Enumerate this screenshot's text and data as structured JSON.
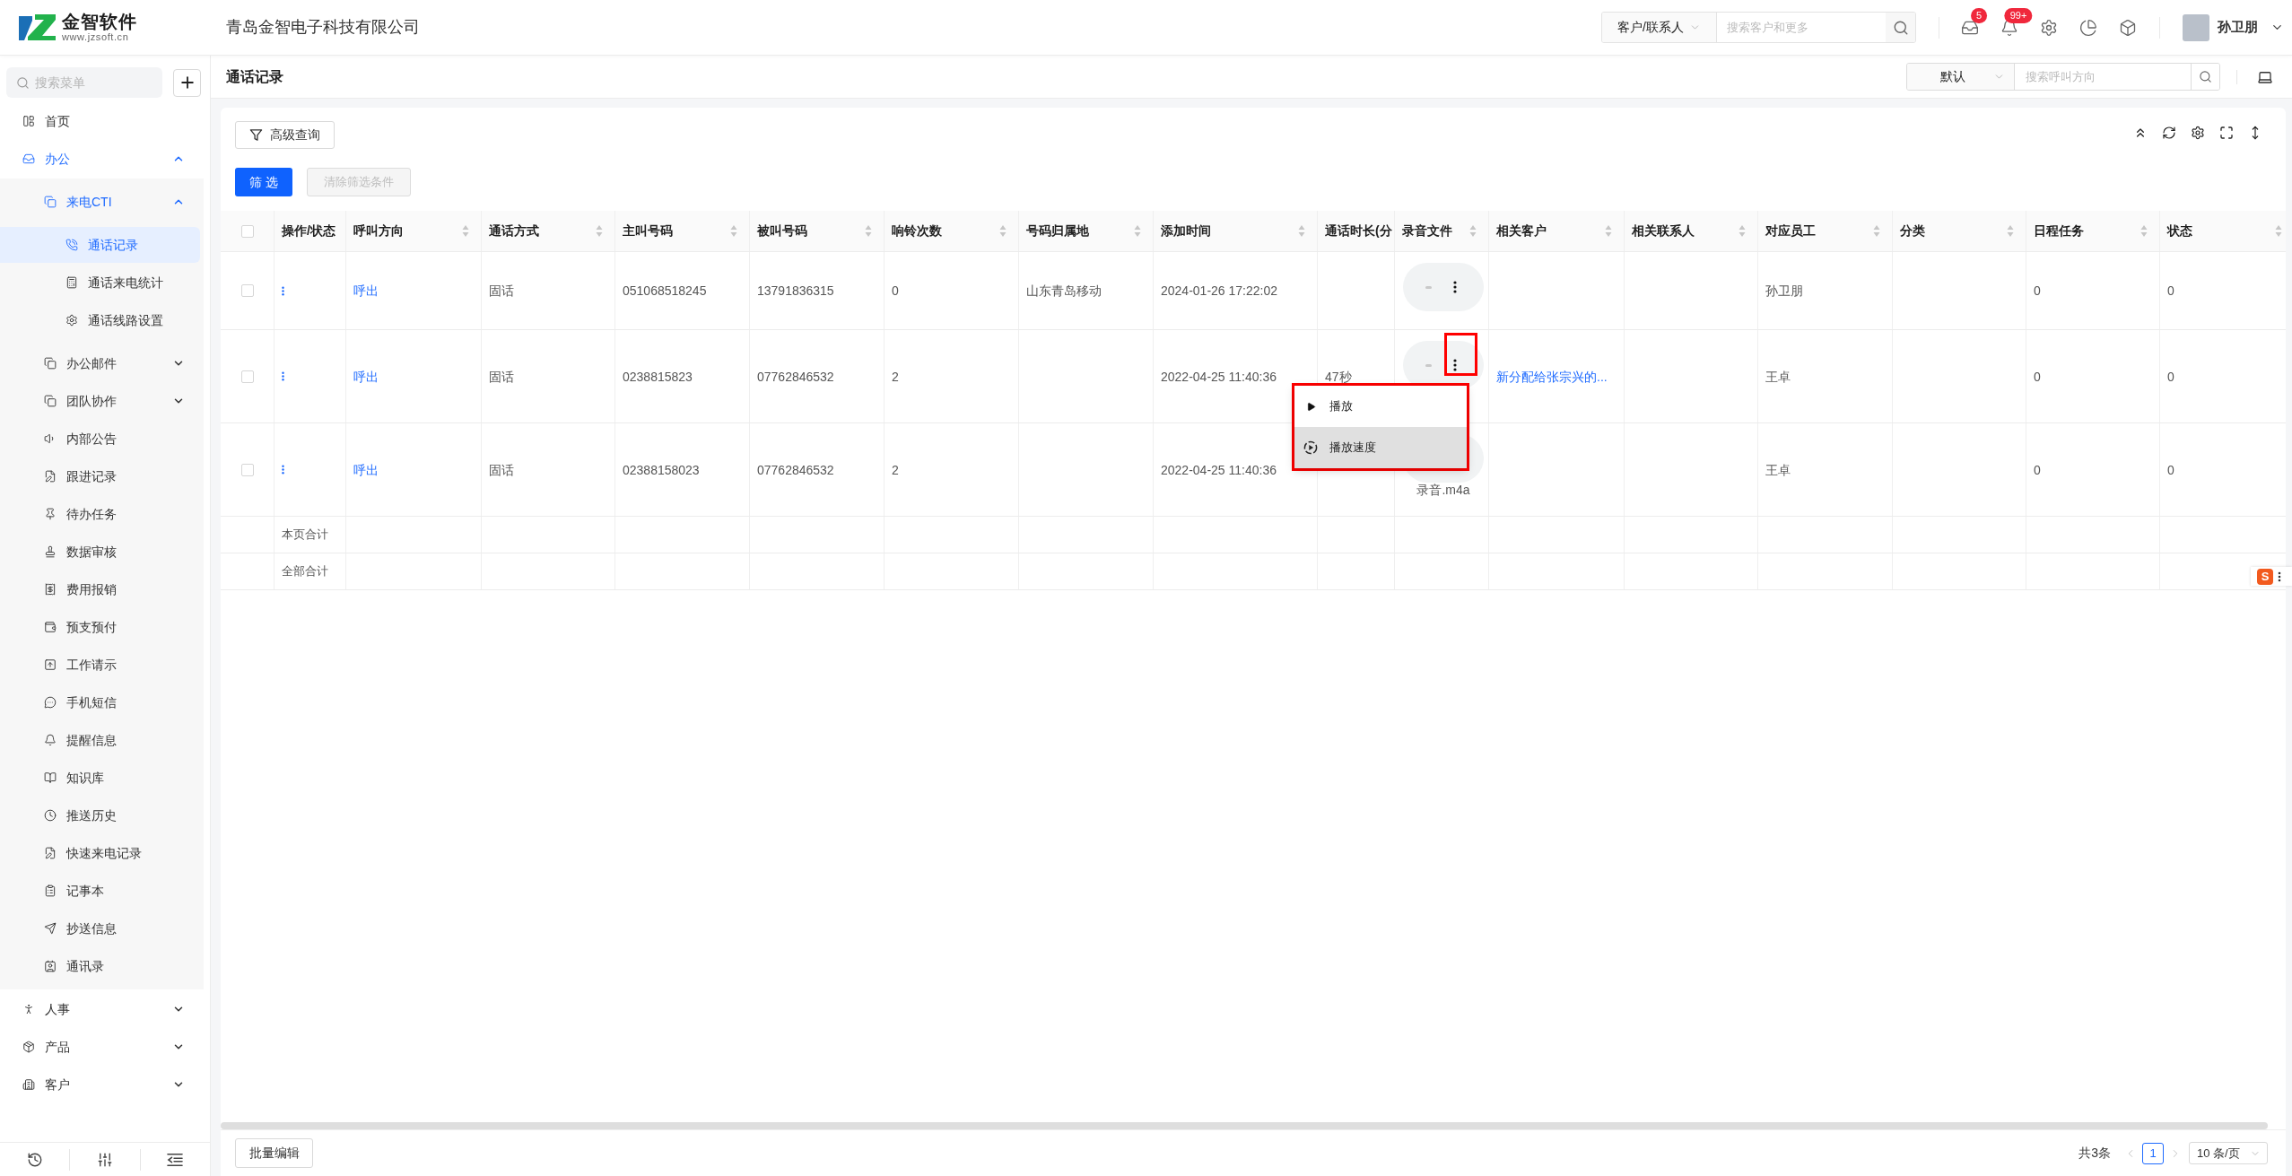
{
  "header": {
    "logo": {
      "name": "金智软件",
      "url": "www.jzsoft.cn"
    },
    "company": "青岛金智电子科技有限公司",
    "search": {
      "scope": "客户/联系人",
      "placeholder": "搜索客户和更多"
    },
    "icons": [
      {
        "kind": "inbox",
        "badge": "5"
      },
      {
        "kind": "bell",
        "badge": "99+"
      },
      {
        "kind": "settings"
      },
      {
        "kind": "chart"
      },
      {
        "kind": "cube"
      }
    ],
    "user": {
      "name": "孙卫朋"
    }
  },
  "sidebar": {
    "search": {
      "placeholder": "搜索菜单"
    },
    "items": [
      {
        "label": "首页",
        "selected": false
      },
      {
        "label": "办公",
        "selected": false,
        "expanded": true,
        "children": [
          {
            "label": "来电CTI",
            "selected": false,
            "expanded": true,
            "children": [
              {
                "label": "通话记录",
                "selected": true
              },
              {
                "label": "通话来电统计",
                "selected": false
              },
              {
                "label": "通话线路设置",
                "selected": false
              }
            ]
          },
          {
            "label": "办公邮件",
            "selected": false,
            "expanded": false
          },
          {
            "label": "团队协作",
            "selected": false,
            "expanded": false
          },
          {
            "label": "内部公告",
            "selected": false
          },
          {
            "label": "跟进记录",
            "selected": false
          },
          {
            "label": "待办任务",
            "selected": false
          },
          {
            "label": "数据审核",
            "selected": false
          },
          {
            "label": "费用报销",
            "selected": false
          },
          {
            "label": "预支预付",
            "selected": false
          },
          {
            "label": "工作请示",
            "selected": false
          },
          {
            "label": "手机短信",
            "selected": false
          },
          {
            "label": "提醒信息",
            "selected": false
          },
          {
            "label": "知识库",
            "selected": false
          },
          {
            "label": "推送历史",
            "selected": false
          },
          {
            "label": "快速来电记录",
            "selected": false
          },
          {
            "label": "记事本",
            "selected": false
          },
          {
            "label": "抄送信息",
            "selected": false
          },
          {
            "label": "通讯录",
            "selected": false
          }
        ]
      },
      {
        "label": "人事",
        "selected": false,
        "expanded": false
      },
      {
        "label": "产品",
        "selected": false,
        "expanded": false
      },
      {
        "label": "客户",
        "selected": false,
        "expanded": false
      }
    ]
  },
  "page": {
    "title": "通话记录",
    "filter": {
      "preset": "默认",
      "placeholder": "搜索呼叫方向"
    }
  },
  "toolbar": {
    "advanced_search": "高级查询",
    "filter_button": "筛 选",
    "clear_button": {
      "label": "清除筛选条件",
      "disabled": true
    }
  },
  "table": {
    "all_checked": false,
    "columns": [
      {
        "label": "操作/状态",
        "sortable": false
      },
      {
        "label": "呼叫方向",
        "sortable": true
      },
      {
        "label": "通话方式",
        "sortable": true
      },
      {
        "label": "主叫号码",
        "sortable": true
      },
      {
        "label": "被叫号码",
        "sortable": true
      },
      {
        "label": "响铃次数",
        "sortable": true
      },
      {
        "label": "号码归属地",
        "sortable": true
      },
      {
        "label": "添加时间",
        "sortable": true
      },
      {
        "label": "通话时长(分",
        "sortable": false
      },
      {
        "label": "录音文件",
        "sortable": true
      },
      {
        "label": "相关客户",
        "sortable": true
      },
      {
        "label": "相关联系人",
        "sortable": true
      },
      {
        "label": "对应员工",
        "sortable": true
      },
      {
        "label": "分类",
        "sortable": true
      },
      {
        "label": "日程任务",
        "sortable": true
      },
      {
        "label": "状态",
        "sortable": true
      }
    ],
    "rows": [
      {
        "checked": false,
        "direction": "呼出",
        "call_type": "固话",
        "caller": "051068518245",
        "callee": "13791836315",
        "rings": "0",
        "location": "山东青岛移动",
        "added": "2024-01-26 17:22:02",
        "recording": {
          "menu_button": {
            "highlighted": false
          }
        },
        "employee": "孙卫朋",
        "schedule": "0",
        "status": "0"
      },
      {
        "checked": false,
        "direction": "呼出",
        "call_type": "固话",
        "caller": "0238815823",
        "callee": "07762846532",
        "rings": "2",
        "added": "2022-04-25 11:40:36",
        "duration": "47秒",
        "recording": {
          "menu_button": {
            "highlighted": true
          },
          "menu": {
            "highlighted": true,
            "items": [
              {
                "kind": "play",
                "label": "播放",
                "selected": false
              },
              {
                "kind": "speed",
                "label": "播放速度",
                "selected": true
              }
            ]
          }
        },
        "customer": "新分配给张宗兴的...",
        "employee": "王卓",
        "schedule": "0",
        "status": "0"
      },
      {
        "checked": false,
        "direction": "呼出",
        "call_type": "固话",
        "caller": "02388158023",
        "callee": "07762846532",
        "rings": "2",
        "added": "2022-04-25 11:40:36",
        "recording": {
          "file_name": "录音.m4a"
        },
        "employee": "王卓",
        "schedule": "0",
        "status": "0"
      }
    ],
    "summary_rows": [
      "本页合计",
      "全部合计"
    ]
  },
  "footer": {
    "batch_edit": "批量编辑",
    "total": "共3条",
    "pages": [
      {
        "label": "1",
        "selected": true
      }
    ],
    "page_size": "10 条/页"
  },
  "ime_toolbar": {
    "logo": "S"
  }
}
